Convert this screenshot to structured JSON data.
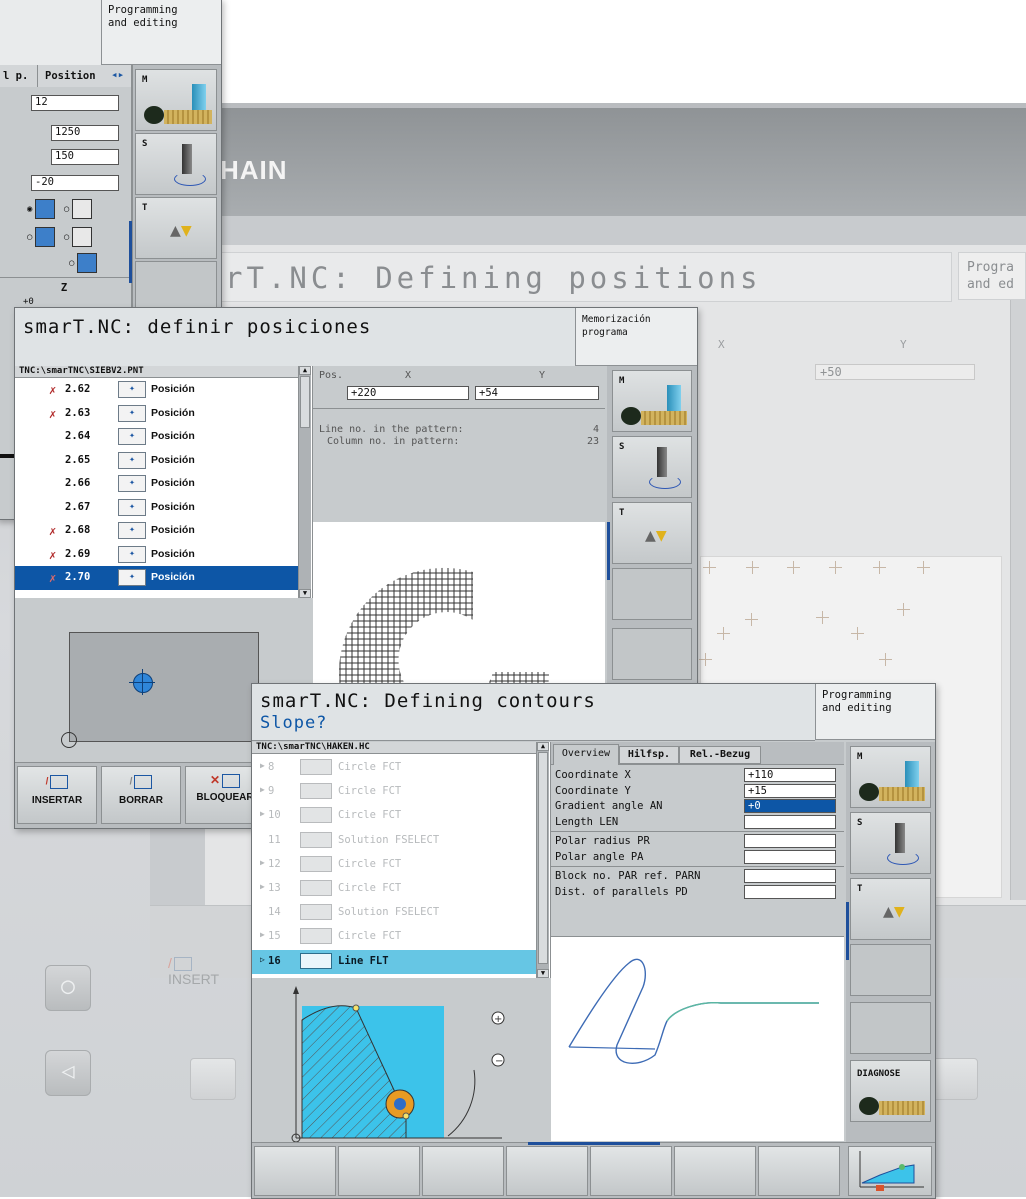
{
  "background": {
    "brand": "HAIN",
    "title": "rT.NC: Defining positions",
    "mode": "Progra\nand ed",
    "pos_header_x": "X",
    "pos_header_y": "Y",
    "pos_value": "+50",
    "softkey_insert": "INSERT"
  },
  "window1": {
    "mode": "Programming\nand editing",
    "tab1": "l p.",
    "tab2": "Position",
    "fields": [
      "12",
      "1250",
      "150",
      "-20"
    ],
    "axis_label": "Z",
    "bottom_value": "+0",
    "softkeys": [
      "M",
      "S",
      "T"
    ]
  },
  "window2": {
    "title": "smarT.NC: definir posiciones",
    "mode": "Memorización\nprograma",
    "path": "TNC:\\smarTNC\\SIEBV2.PNT",
    "rows": [
      {
        "mark": "✗",
        "num": "2.62",
        "label": "Posición"
      },
      {
        "mark": "✗",
        "num": "2.63",
        "label": "Posición"
      },
      {
        "mark": "",
        "num": "2.64",
        "label": "Posición"
      },
      {
        "mark": "",
        "num": "2.65",
        "label": "Posición"
      },
      {
        "mark": "",
        "num": "2.66",
        "label": "Posición"
      },
      {
        "mark": "",
        "num": "2.67",
        "label": "Posición"
      },
      {
        "mark": "✗",
        "num": "2.68",
        "label": "Posición"
      },
      {
        "mark": "✗",
        "num": "2.69",
        "label": "Posición"
      },
      {
        "mark": "✗",
        "num": "2.70",
        "label": "Posición"
      }
    ],
    "pos_label": "Pos.",
    "x_label": "X",
    "y_label": "Y",
    "x_value": "+220",
    "y_value": "+54",
    "info_line_label": "Line no. in the pattern:",
    "info_line_value": "4",
    "info_col_label": "Column no. in pattern:",
    "info_col_value": "23",
    "softkeys_right": [
      "M",
      "S",
      "T"
    ],
    "softkeys_bottom": [
      "INSERTAR",
      "BORRAR",
      "BLOQUEAR"
    ]
  },
  "window3": {
    "title": "smarT.NC: Defining contours",
    "subtitle": "Slope?",
    "mode": "Programming\nand editing",
    "path": "TNC:\\smarTNC\\HAKEN.HC",
    "rows": [
      {
        "num": "8",
        "text": "Circle FCT",
        "arrow": "▶"
      },
      {
        "num": "9",
        "text": "Circle FCT",
        "arrow": "▶"
      },
      {
        "num": "10",
        "text": "Circle FCT",
        "arrow": "▶"
      },
      {
        "num": "11",
        "text": "Solution FSELECT",
        "arrow": ""
      },
      {
        "num": "12",
        "text": "Circle FCT",
        "arrow": "▶"
      },
      {
        "num": "13",
        "text": "Circle FCT",
        "arrow": "▶"
      },
      {
        "num": "14",
        "text": "Solution FSELECT",
        "arrow": ""
      },
      {
        "num": "15",
        "text": "Circle FCT",
        "arrow": "▶"
      },
      {
        "num": "16",
        "text": "Line FLT",
        "arrow": "▷"
      }
    ],
    "tabs": [
      "Overview",
      "Hilfsp.",
      "Rel.-Bezug"
    ],
    "fields": [
      {
        "label": "Coordinate X",
        "value": "+110"
      },
      {
        "label": "Coordinate Y",
        "value": "+15"
      },
      {
        "label": "Gradient angle AN",
        "value": "+0"
      },
      {
        "label": "Length LEN",
        "value": ""
      },
      {
        "label": "Polar radius PR",
        "value": ""
      },
      {
        "label": "Polar angle PA",
        "value": ""
      },
      {
        "label": "Block no. PAR ref. PARN",
        "value": ""
      },
      {
        "label": "Dist. of parallels PD",
        "value": ""
      }
    ],
    "softkeys_right": [
      "M",
      "S",
      "T"
    ],
    "diagnose": "DIAGNOSE"
  },
  "colors": {
    "selection_blue": "#0d56a6",
    "selection_cyan": "#66c6e4",
    "graphic_cyan": "#3cc3ea",
    "contour_blue": "#3d6bb5",
    "contour_green": "#5bb9a0"
  }
}
